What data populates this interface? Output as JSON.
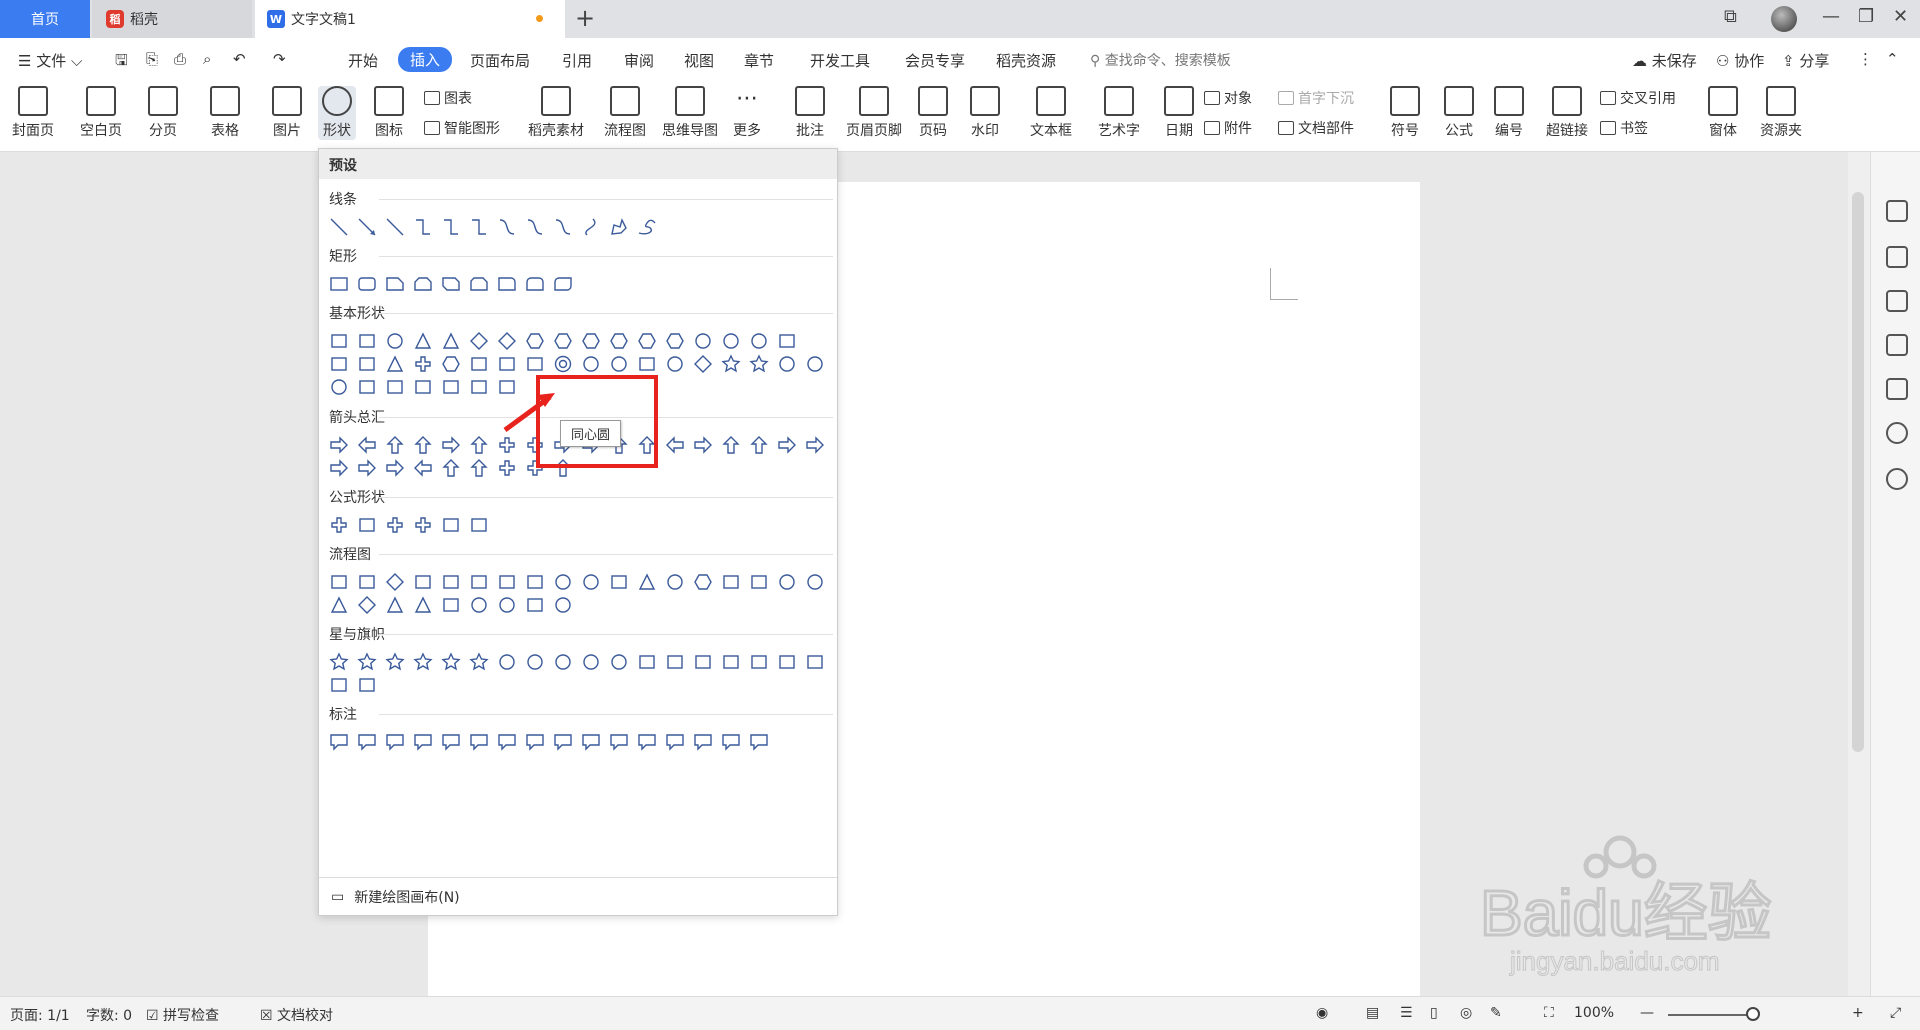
{
  "tabs": {
    "home": "首页",
    "daoke": "稻壳",
    "doc": "文字文稿1"
  },
  "menu": {
    "file": "文件",
    "items": [
      "开始",
      "插入",
      "页面布局",
      "引用",
      "审阅",
      "视图",
      "章节",
      "开发工具",
      "会员专享",
      "稻壳资源"
    ],
    "search": "查找命令、搜索模板",
    "unsaved": "未保存",
    "collab": "协作",
    "share": "分享"
  },
  "ribbon": {
    "cover": "封面页",
    "blank": "空白页",
    "pagebreak": "分页",
    "table": "表格",
    "picture": "图片",
    "shape": "形状",
    "icon": "图标",
    "chart": "图表",
    "smartart": "智能图形",
    "material": "稻壳素材",
    "flow": "流程图",
    "mind": "思维导图",
    "more": "更多",
    "comment": "批注",
    "headerfooter": "页眉页脚",
    "pagenum": "页码",
    "watermark": "水印",
    "textbox": "文本框",
    "wordart": "艺术字",
    "date": "日期",
    "object": "对象",
    "attach": "附件",
    "dropcap": "首字下沉",
    "docpart": "文档部件",
    "symbol": "符号",
    "formula": "公式",
    "numbering": "编号",
    "hyperlink": "超链接",
    "crossref": "交叉引用",
    "bookmark": "书签",
    "window": "窗体",
    "resource": "资源夹"
  },
  "dropdown": {
    "header": "预设",
    "sections": [
      "线条",
      "矩形",
      "基本形状",
      "箭头总汇",
      "公式形状",
      "流程图",
      "星与旗帜",
      "标注"
    ],
    "footer": "新建绘图画布(N)",
    "tooltip": "同心圆"
  },
  "status": {
    "page": "页面: 1/1",
    "words": "字数: 0",
    "spell": "拼写检查",
    "proof": "文档校对",
    "zoom": "100%"
  },
  "watermark": {
    "brand": "Baidu经验",
    "url": "jingyan.baidu.com"
  }
}
